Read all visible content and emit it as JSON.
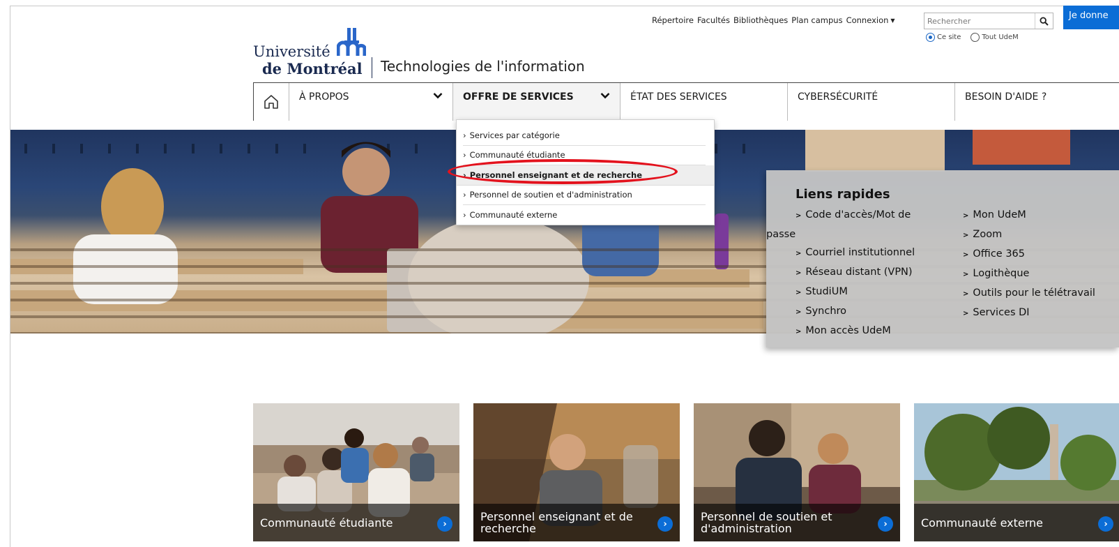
{
  "utility": {
    "links": [
      "Répertoire",
      "Facultés",
      "Bibliothèques",
      "Plan campus"
    ],
    "connexion": "Connexion",
    "search_placeholder": "Rechercher",
    "scope_site": "Ce site",
    "scope_all": "Tout UdeM",
    "donate": "Je donne"
  },
  "logo": {
    "line1": "Université",
    "line2": "de Montréal",
    "subtitle": "Technologies de l'information"
  },
  "nav": {
    "items": [
      {
        "label": "À PROPOS"
      },
      {
        "label": "OFFRE DE SERVICES"
      },
      {
        "label": "ÉTAT DES SERVICES"
      },
      {
        "label": "CYBERSÉCURITÉ"
      },
      {
        "label": "BESOIN D'AIDE ?"
      }
    ]
  },
  "dropdown": {
    "items": [
      "Services par catégorie",
      "Communauté étudiante",
      "Personnel enseignant et de recherche",
      "Personnel de soutien et d'administration",
      "Communauté externe"
    ]
  },
  "quick_links": {
    "title": "Liens rapides",
    "left": [
      "Code d'accès/Mot de",
      "passe",
      "Courriel institutionnel",
      "Réseau distant (VPN)",
      "StudiUM",
      "Synchro",
      "Mon accès UdeM"
    ],
    "right": [
      "Mon UdeM",
      "Zoom",
      "Office 365",
      "Logithèque",
      "Outils pour le télétravail",
      "Services DI"
    ]
  },
  "cards": [
    {
      "label": "Communauté étudiante"
    },
    {
      "label": "Personnel enseignant et de recherche"
    },
    {
      "label": "Personnel de soutien et d'administration"
    },
    {
      "label": "Communauté externe"
    }
  ],
  "colors": {
    "accent_blue": "#0b6dd6",
    "highlight_red": "#e3121d",
    "brand_navy": "#1a2a50"
  }
}
